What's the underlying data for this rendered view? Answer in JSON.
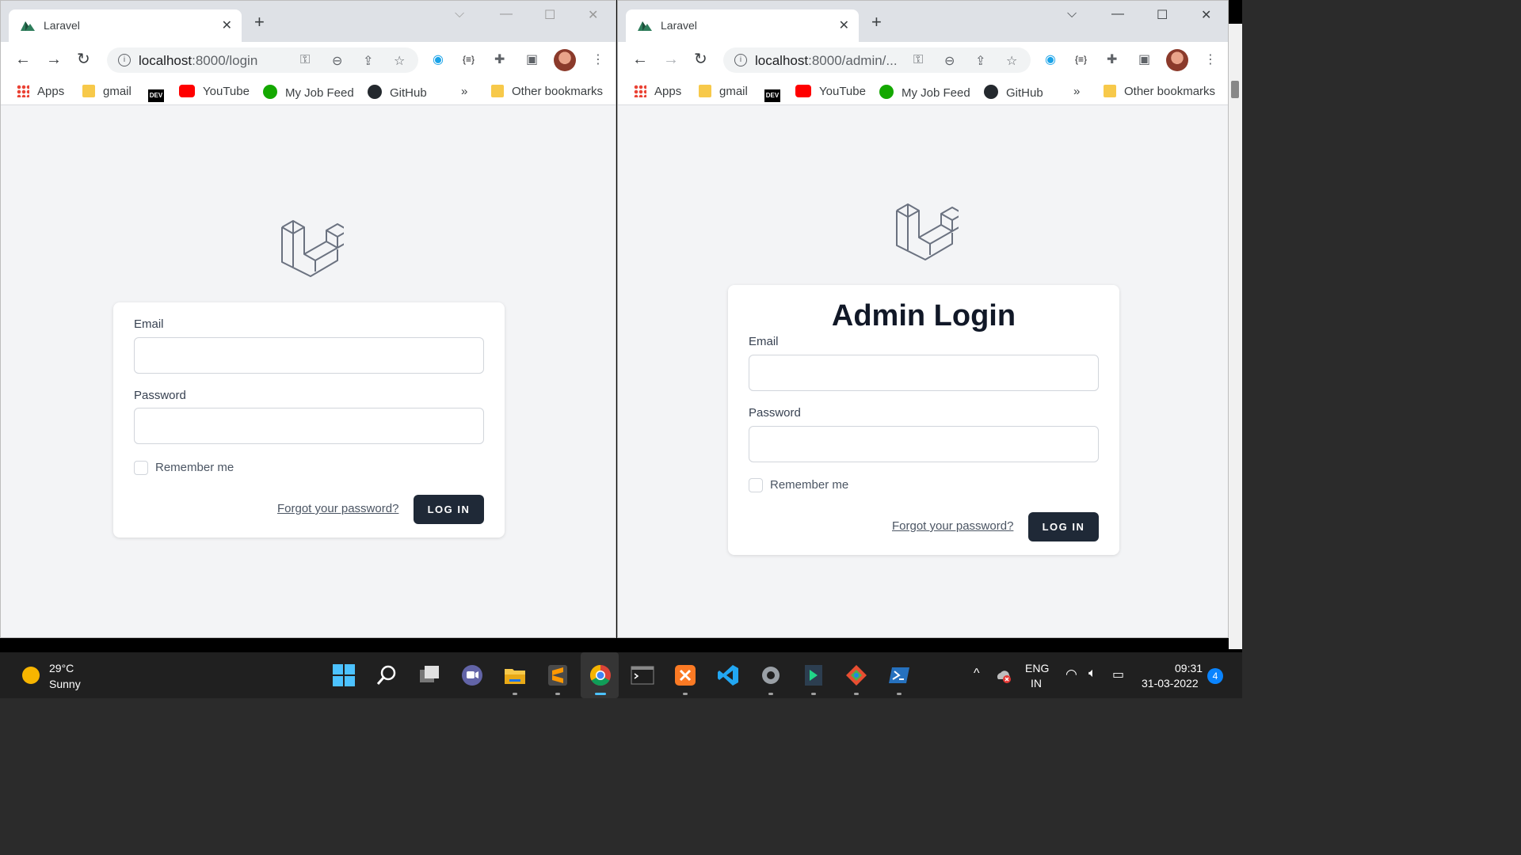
{
  "windows": [
    {
      "tab_title": "Laravel",
      "url_host": "localhost",
      "url_rest": ":8000/login",
      "page": {
        "heading": "",
        "email_label": "Email",
        "password_label": "Password",
        "remember_label": "Remember me",
        "forgot_link": "Forgot your password?",
        "login_button": "LOG IN"
      }
    },
    {
      "tab_title": "Laravel",
      "url_host": "localhost",
      "url_rest": ":8000/admin/...",
      "page": {
        "heading": "Admin Login",
        "email_label": "Email",
        "password_label": "Password",
        "remember_label": "Remember me",
        "forgot_link": "Forgot your password?",
        "login_button": "LOG IN"
      }
    }
  ],
  "bookmarks": {
    "apps": "Apps",
    "gmail": "gmail",
    "dev": "DEV",
    "youtube": "YouTube",
    "jobfeed": "My Job Feed",
    "github": "GitHub",
    "more": "»",
    "other": "Other bookmarks"
  },
  "taskbar": {
    "temperature": "29°C",
    "weather": "Sunny",
    "lang_top": "ENG",
    "lang_bottom": "IN",
    "time": "09:31",
    "date": "31-03-2022",
    "notifications": "4"
  },
  "colors": {
    "page_bg": "#f3f4f6",
    "button_bg": "#1f2937",
    "laravel_logo": "#6b7280"
  }
}
